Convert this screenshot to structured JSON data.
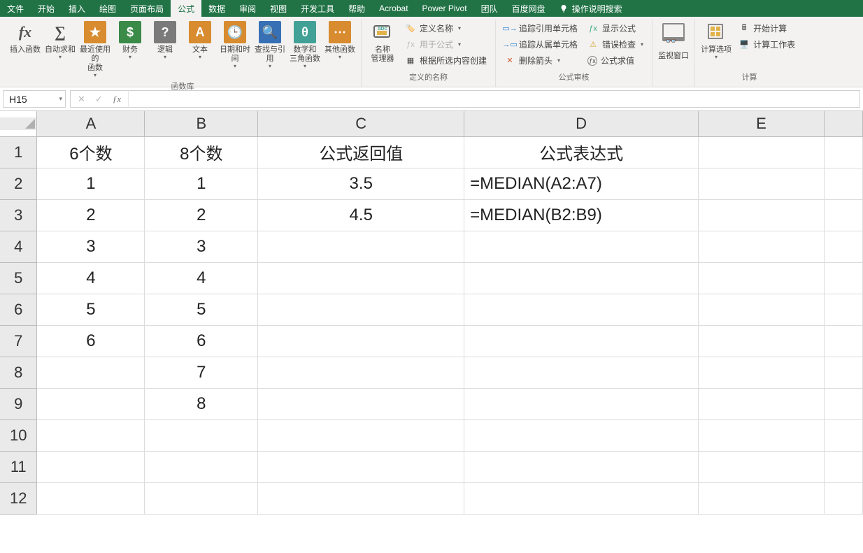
{
  "menu": {
    "tabs": [
      "文件",
      "开始",
      "插入",
      "绘图",
      "页面布局",
      "公式",
      "数据",
      "审阅",
      "视图",
      "开发工具",
      "帮助",
      "Acrobat",
      "Power Pivot",
      "团队",
      "百度网盘"
    ],
    "active_index": 5,
    "search_hint": "操作说明搜索"
  },
  "ribbon": {
    "insert_fn": {
      "label": "插入函数"
    },
    "autosum": {
      "label": "自动求和"
    },
    "recent": {
      "label": "最近使用的\n函数"
    },
    "financial": {
      "label": "财务"
    },
    "logical": {
      "label": "逻辑"
    },
    "text": {
      "label": "文本"
    },
    "datetime": {
      "label": "日期和时间"
    },
    "lookup": {
      "label": "查找与引用"
    },
    "math": {
      "label": "数学和\n三角函数"
    },
    "more": {
      "label": "其他函数"
    },
    "lib_group": "函数库",
    "name_mgr": {
      "label": "名称\n管理器"
    },
    "define_name": "定义名称",
    "use_in_formula": "用于公式",
    "create_from_sel": "根据所选内容创建",
    "names_group": "定义的名称",
    "trace_prec": "追踪引用单元格",
    "trace_dep": "追踪从属单元格",
    "remove_arrows": "删除箭头",
    "show_formulas": "显示公式",
    "error_check": "错误检查",
    "eval_formula": "公式求值",
    "audit_group": "公式审核",
    "watch": {
      "label": "监视窗口"
    },
    "calc_options": {
      "label": "计算选项"
    },
    "calc_now": "开始计算",
    "calc_sheet": "计算工作表",
    "calc_group": "计算"
  },
  "formula_bar": {
    "namebox": "H15",
    "value": ""
  },
  "columns": [
    "A",
    "B",
    "C",
    "D",
    "E",
    ""
  ],
  "rows": [
    "1",
    "2",
    "3",
    "4",
    "5",
    "6",
    "7",
    "8",
    "9",
    "10",
    "11",
    "12"
  ],
  "cells": {
    "A1": "6个数",
    "B1": "8个数",
    "C1": "公式返回值",
    "D1": "公式表达式",
    "A2": "1",
    "B2": "1",
    "C2": "3.5",
    "D2": "=MEDIAN(A2:A7)",
    "A3": "2",
    "B3": "2",
    "C3": "4.5",
    "D3": "=MEDIAN(B2:B9)",
    "A4": "3",
    "B4": "3",
    "A5": "4",
    "B5": "4",
    "A6": "5",
    "B6": "5",
    "A7": "6",
    "B7": "6",
    "B8": "7",
    "B9": "8"
  }
}
